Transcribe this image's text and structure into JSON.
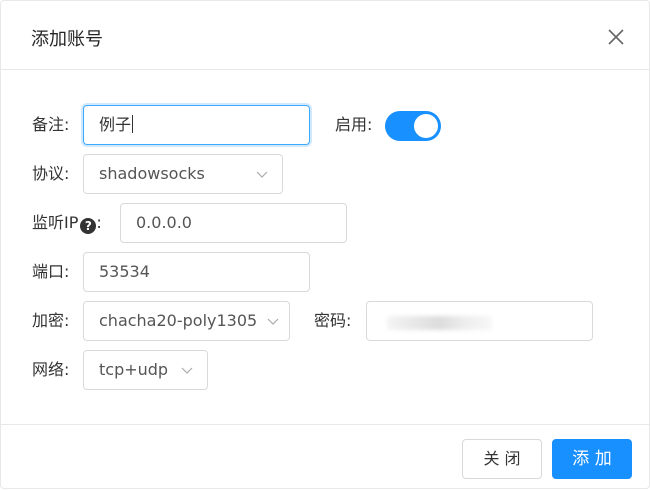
{
  "dialog": {
    "title": "添加账号",
    "close_icon": "close-icon"
  },
  "form": {
    "remark": {
      "label": "备注:",
      "value": "例子"
    },
    "enable": {
      "label": "启用:",
      "checked": true,
      "accent": "#1890ff"
    },
    "protocol": {
      "label": "协议:",
      "value": "shadowsocks",
      "icon": "chevron-down-icon"
    },
    "listen_ip": {
      "label": "监听IP",
      "help": "?",
      "colon": ":",
      "value": "0.0.0.0"
    },
    "port": {
      "label": "端口:",
      "value": "53534"
    },
    "encryption": {
      "label": "加密:",
      "value": "chacha20-poly1305",
      "icon": "chevron-down-icon"
    },
    "password": {
      "label": "密码:"
    },
    "network": {
      "label": "网络:",
      "value": "tcp+udp",
      "icon": "chevron-down-icon"
    }
  },
  "footer": {
    "close_label": "关 闭",
    "add_label": "添 加",
    "primary_color": "#1890ff"
  }
}
